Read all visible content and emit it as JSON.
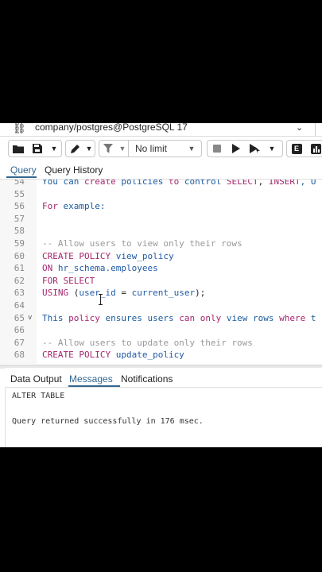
{
  "connection": {
    "label": "company/postgres@PostgreSQL 17"
  },
  "toolbar": {
    "limit_label": "No limit"
  },
  "editor_tabs": [
    {
      "label": "Query",
      "active": true
    },
    {
      "label": "Query History",
      "active": false
    }
  ],
  "code_lines": [
    {
      "num": "54",
      "fold": "",
      "tokens": [
        {
          "t": "You ",
          "c": "tx"
        },
        {
          "t": "can ",
          "c": "tx"
        },
        {
          "t": "create",
          "c": "kw"
        },
        {
          "t": " policies ",
          "c": "tx"
        },
        {
          "t": "to",
          "c": "kw"
        },
        {
          "t": " control ",
          "c": "tx"
        },
        {
          "t": "SELECT",
          "c": "kw"
        },
        {
          "t": ", ",
          "c": "op"
        },
        {
          "t": "INSERT",
          "c": "kw"
        },
        {
          "t": ", U",
          "c": "tx"
        }
      ]
    },
    {
      "num": "55",
      "fold": "",
      "tokens": []
    },
    {
      "num": "56",
      "fold": "",
      "tokens": [
        {
          "t": "For",
          "c": "kw"
        },
        {
          "t": " example:",
          "c": "tx"
        }
      ]
    },
    {
      "num": "57",
      "fold": "",
      "tokens": []
    },
    {
      "num": "58",
      "fold": "",
      "tokens": []
    },
    {
      "num": "59",
      "fold": "",
      "tokens": [
        {
          "t": "-- Allow users to view only their rows",
          "c": "cm"
        }
      ]
    },
    {
      "num": "60",
      "fold": "",
      "tokens": [
        {
          "t": "CREATE POLICY",
          "c": "kw"
        },
        {
          "t": " view_policy",
          "c": "id"
        }
      ]
    },
    {
      "num": "61",
      "fold": "",
      "tokens": [
        {
          "t": "ON",
          "c": "kw"
        },
        {
          "t": " hr_schema.employees",
          "c": "id"
        }
      ]
    },
    {
      "num": "62",
      "fold": "",
      "tokens": [
        {
          "t": "FOR SELECT",
          "c": "kw"
        }
      ]
    },
    {
      "num": "63",
      "fold": "",
      "tokens": [
        {
          "t": "USING",
          "c": "kw"
        },
        {
          "t": " (",
          "c": "op"
        },
        {
          "t": "user_id",
          "c": "id"
        },
        {
          "t": " = ",
          "c": "op"
        },
        {
          "t": "current_user",
          "c": "id"
        },
        {
          "t": ");",
          "c": "op"
        }
      ]
    },
    {
      "num": "64",
      "fold": "",
      "tokens": []
    },
    {
      "num": "65",
      "fold": "v",
      "tokens": [
        {
          "t": "This ",
          "c": "tx"
        },
        {
          "t": "policy",
          "c": "kw"
        },
        {
          "t": " ensures users ",
          "c": "tx"
        },
        {
          "t": "can",
          "c": "kw"
        },
        {
          "t": " ",
          "c": "tx"
        },
        {
          "t": "only",
          "c": "kw"
        },
        {
          "t": " view rows ",
          "c": "tx"
        },
        {
          "t": "where",
          "c": "kw"
        },
        {
          "t": " t",
          "c": "tx"
        }
      ]
    },
    {
      "num": "66",
      "fold": "",
      "tokens": []
    },
    {
      "num": "67",
      "fold": "",
      "tokens": [
        {
          "t": "-- Allow users to update only their rows",
          "c": "cm"
        }
      ]
    },
    {
      "num": "68",
      "fold": "",
      "tokens": [
        {
          "t": "CREATE POLICY",
          "c": "kw"
        },
        {
          "t": " update_policy",
          "c": "id"
        }
      ]
    }
  ],
  "output_tabs": [
    {
      "label": "Data Output",
      "active": false
    },
    {
      "label": "Messages",
      "active": true
    },
    {
      "label": "Notifications",
      "active": false
    }
  ],
  "messages": [
    "ALTER TABLE",
    "",
    "Query returned successfully in 176 msec."
  ]
}
